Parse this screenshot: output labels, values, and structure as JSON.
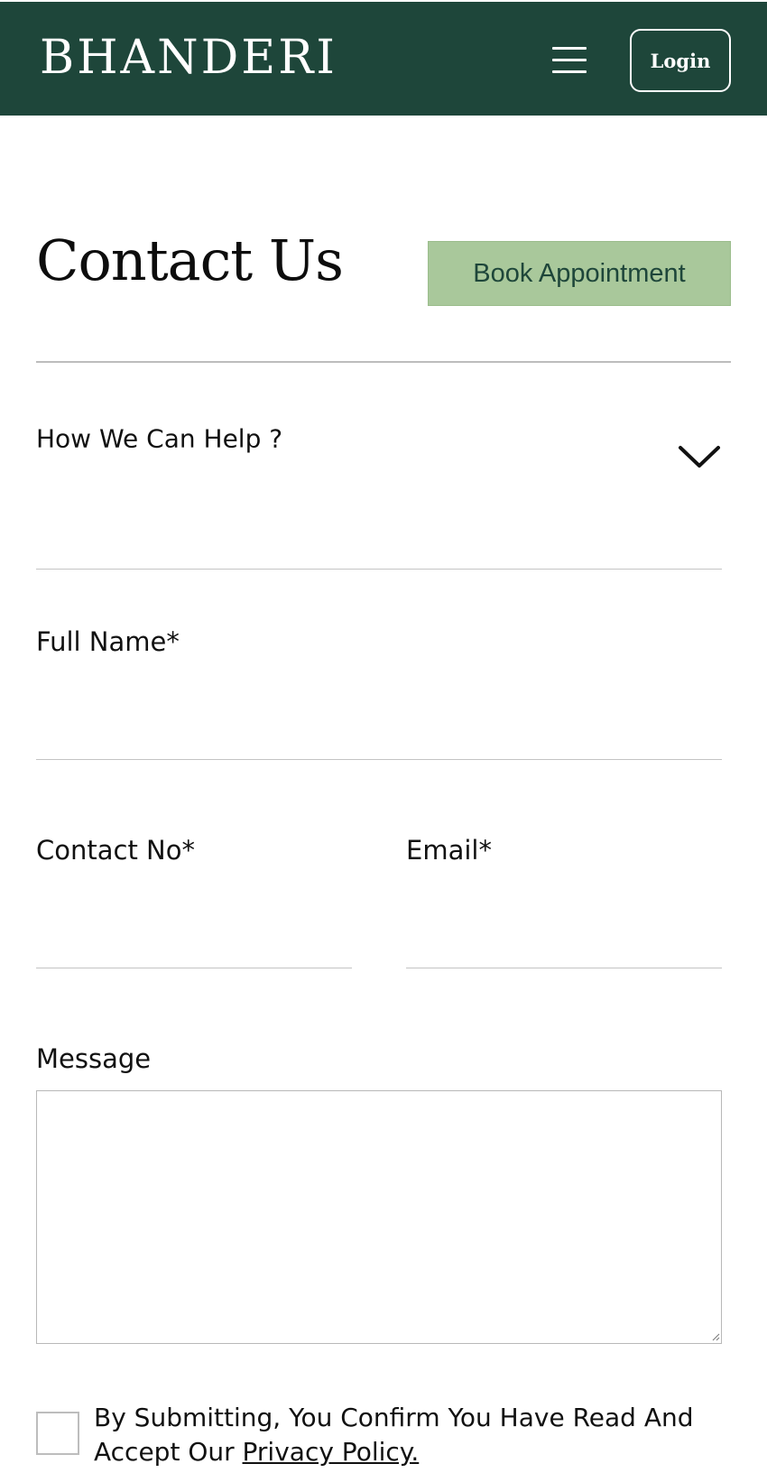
{
  "header": {
    "logo": "BHANDERI",
    "menu_icon": "hamburger-menu-icon",
    "login_label": "Login",
    "background": "#1e463a"
  },
  "main": {
    "title": "Contact Us",
    "book_appointment_label": "Book Appointment",
    "accent": "#a9c89b"
  },
  "form": {
    "help_select": {
      "label": "How We Can Help ?",
      "icon": "chevron-down-icon"
    },
    "full_name": {
      "label": "Full Name*",
      "value": ""
    },
    "contact_no": {
      "label": "Contact No*",
      "value": ""
    },
    "email": {
      "label": "Email*",
      "value": ""
    },
    "message": {
      "label": "Message",
      "value": ""
    },
    "consent": {
      "text": "By Submitting, You Confirm You Have Read And Accept Our ",
      "link": "Privacy Policy.",
      "checked": false
    }
  }
}
